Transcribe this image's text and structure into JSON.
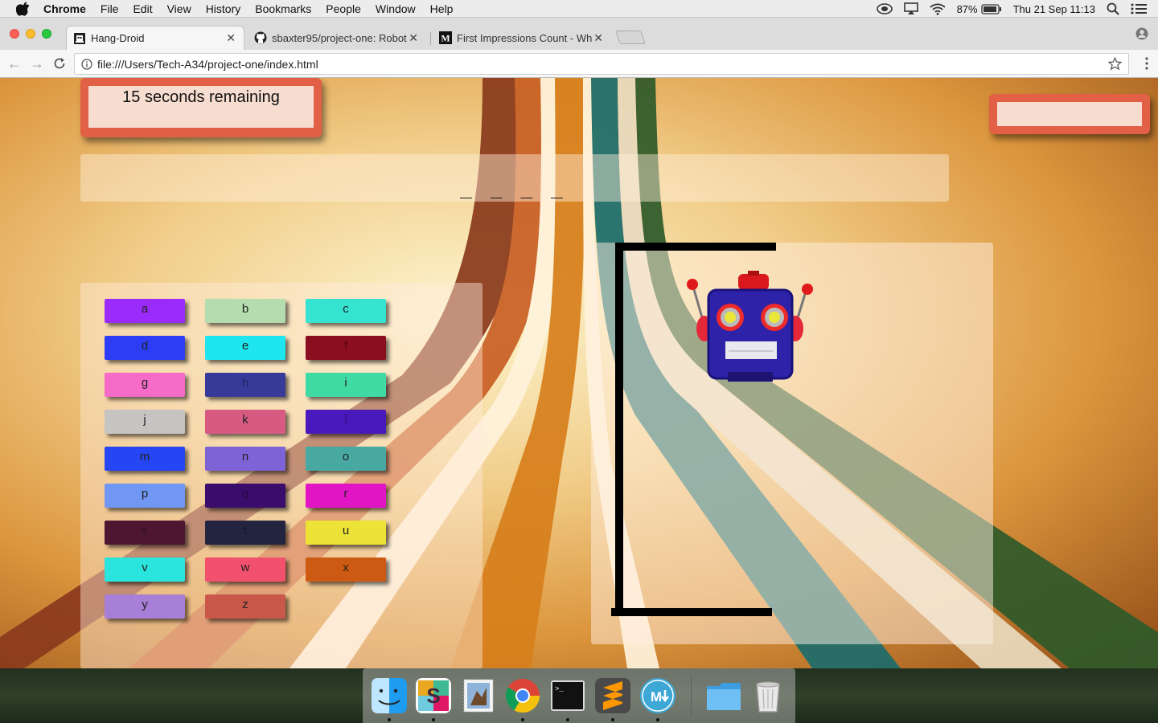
{
  "menubar": {
    "app_name": "Chrome",
    "items": [
      "File",
      "Edit",
      "View",
      "History",
      "Bookmarks",
      "People",
      "Window",
      "Help"
    ],
    "battery": "87%",
    "clock": "Thu 21 Sep  11:13"
  },
  "tabs": [
    {
      "title": "Hang-Droid",
      "icon": "robot-favicon",
      "active": true
    },
    {
      "title": "sbaxter95/project-one: Robot",
      "icon": "github-icon",
      "active": false
    },
    {
      "title": "First Impressions Count - Why",
      "icon": "medium-icon",
      "active": false
    }
  ],
  "toolbar": {
    "url": "file:///Users/Tech-A34/project-one/index.html"
  },
  "game": {
    "timer_text": "15 seconds remaining",
    "score_text": "",
    "word_blanks": "_ _ _ _",
    "letters": [
      {
        "label": "a",
        "color": "#9b2bfa"
      },
      {
        "label": "b",
        "color": "#b5dcae"
      },
      {
        "label": "c",
        "color": "#36e3d1"
      },
      {
        "label": "d",
        "color": "#2c3df5"
      },
      {
        "label": "e",
        "color": "#1ee6ee"
      },
      {
        "label": "f",
        "color": "#8b0e1f"
      },
      {
        "label": "g",
        "color": "#f66ac8"
      },
      {
        "label": "h",
        "color": "#373a98"
      },
      {
        "label": "i",
        "color": "#40dba5"
      },
      {
        "label": "j",
        "color": "#c6c4c3"
      },
      {
        "label": "k",
        "color": "#d65a82"
      },
      {
        "label": "l",
        "color": "#4a19bb"
      },
      {
        "label": "m",
        "color": "#2546f2"
      },
      {
        "label": "n",
        "color": "#7e63d6"
      },
      {
        "label": "o",
        "color": "#48a9a2"
      },
      {
        "label": "p",
        "color": "#6f97f3"
      },
      {
        "label": "q",
        "color": "#3a0c6b"
      },
      {
        "label": "r",
        "color": "#e215c5"
      },
      {
        "label": "s",
        "color": "#4e1631"
      },
      {
        "label": "t",
        "color": "#232440"
      },
      {
        "label": "u",
        "color": "#ede236"
      },
      {
        "label": "v",
        "color": "#2ae5de"
      },
      {
        "label": "w",
        "color": "#f2516d"
      },
      {
        "label": "x",
        "color": "#cc5a12"
      },
      {
        "label": "y",
        "color": "#a77fd6"
      },
      {
        "label": "z",
        "color": "#c9574a"
      }
    ]
  },
  "dock": {
    "apps": [
      "finder-icon",
      "slack-icon",
      "mail-icon",
      "chrome-icon",
      "terminal-icon",
      "sublime-text-icon",
      "markdown-icon",
      "folder-icon",
      "trash-icon"
    ]
  },
  "colors": {
    "accent_frame": "#e26045",
    "frame_inner": "#f6ddd0"
  }
}
